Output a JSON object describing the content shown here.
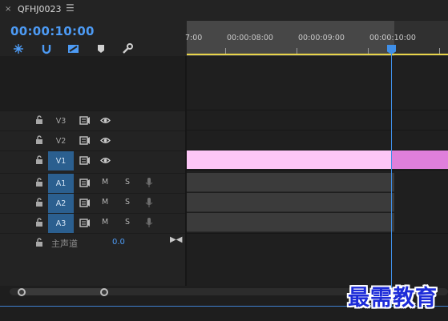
{
  "panel": {
    "close_glyph": "×",
    "title": "QFHJ0023",
    "menu_glyph": "☰"
  },
  "timecode": "00:00:10:00",
  "toolbar": {
    "tools": [
      "snap-icon",
      "linked-selection-icon",
      "add-marker-icon",
      "marker-icon",
      "settings-wrench-icon"
    ]
  },
  "ruler": {
    "labels": [
      "7:00",
      "00:00:08:00",
      "00:00:09:00",
      "00:00:10:00"
    ]
  },
  "tracks": {
    "video": [
      {
        "name": "V3",
        "active": false
      },
      {
        "name": "V2",
        "active": false
      },
      {
        "name": "V1",
        "active": true
      }
    ],
    "audio": [
      {
        "name": "A1",
        "mute": "M",
        "solo": "S"
      },
      {
        "name": "A2",
        "mute": "M",
        "solo": "S"
      },
      {
        "name": "A3",
        "mute": "M",
        "solo": "S"
      }
    ],
    "master": {
      "label": "主声道",
      "value": "0.0",
      "end_glyph": "▶◀"
    }
  },
  "colors": {
    "timecode": "#4d9bf5",
    "playhead": "#3f8fe8",
    "video_clip": "#fdc6f6",
    "video_clip_selected": "#df7fdb",
    "work_area_bar": "#e8d44a",
    "active_track": "#2b5f8f"
  },
  "watermark": "最需教育"
}
